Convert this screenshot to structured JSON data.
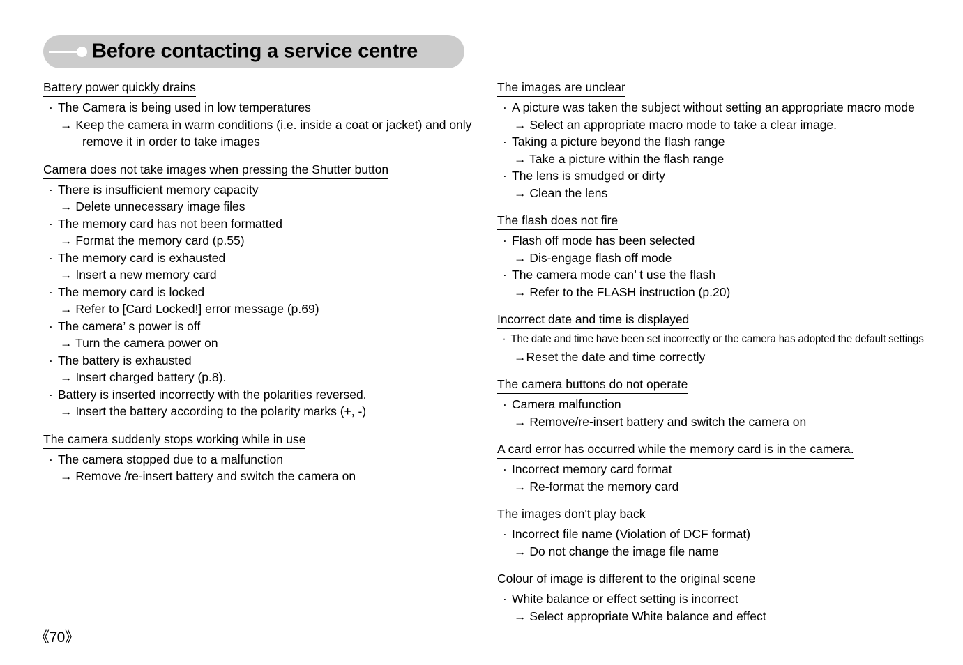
{
  "header": {
    "title": "Before contacting a service centre",
    "line_icon": "horizontal-line-decoration",
    "dot_icon": "bullet-dot-decoration",
    "background_color": "#cccccc"
  },
  "footer": {
    "page_number": "《70》"
  },
  "left_column": {
    "sections": [
      {
        "heading": "Battery power quickly drains",
        "items": [
          {
            "problem": "The Camera is being used in low temperatures",
            "solution": "→ Keep the camera in warm conditions (i.e. inside a coat or jacket) and only",
            "continuation": "remove it in order to take images"
          }
        ]
      },
      {
        "heading": "Camera does not take images when pressing the Shutter button",
        "items": [
          {
            "problem": "There is insufficient memory capacity",
            "solution": "→ Delete unnecessary image files"
          },
          {
            "problem": "The memory card has not been formatted",
            "solution": "→ Format the memory card (p.55)"
          },
          {
            "problem": "The memory card is exhausted",
            "solution": "→ Insert a new memory card"
          },
          {
            "problem": "The memory card is locked",
            "solution": "→ Refer to [Card Locked!] error message (p.69)"
          },
          {
            "problem": "The camera’ s power is off",
            "solution": "→ Turn the camera power on"
          },
          {
            "problem": "The battery is exhausted",
            "solution": "→ Insert charged battery (p.8)."
          },
          {
            "problem": "Battery is inserted incorrectly with the polarities reversed.",
            "solution": "→ Insert the battery according to the polarity marks (+, -)"
          }
        ]
      },
      {
        "heading": "The camera suddenly stops working while in use",
        "items": [
          {
            "problem": "The camera stopped due to a malfunction",
            "solution": "→ Remove /re-insert battery and switch the camera on"
          }
        ]
      }
    ]
  },
  "right_column": {
    "sections": [
      {
        "heading": "The images are unclear",
        "items": [
          {
            "problem": "A picture was taken the subject without setting an appropriate macro mode",
            "solution": "→ Select an appropriate macro mode to take a clear image."
          },
          {
            "problem": "Taking a picture beyond the flash range",
            "solution": "→ Take a picture within the flash range"
          },
          {
            "problem": "The lens is smudged or dirty",
            "solution": "→ Clean the lens"
          }
        ]
      },
      {
        "heading": "The flash does not fire",
        "items": [
          {
            "problem": "Flash off mode has been selected",
            "solution": "→ Dis-engage flash off mode"
          },
          {
            "problem": "The camera mode can’ t use the flash",
            "solution": "→ Refer to the FLASH instruction (p.20)"
          }
        ]
      },
      {
        "heading": "Incorrect date and time is displayed",
        "items": [
          {
            "problem": "The date and time have been set incorrectly or the camera has adopted the default settings",
            "solution": "→Reset the date and time correctly"
          }
        ]
      },
      {
        "heading": "The camera buttons do not operate",
        "items": [
          {
            "problem": "Camera malfunction",
            "solution": "→ Remove/re-insert battery and switch the camera on"
          }
        ]
      },
      {
        "heading": "A card error has occurred while the memory card is in the camera.",
        "items": [
          {
            "problem": "Incorrect memory card format",
            "solution": "→ Re-format the memory card"
          }
        ]
      },
      {
        "heading": "The images don't play back",
        "items": [
          {
            "problem": "Incorrect file name (Violation of DCF format)",
            "solution": "→ Do not change the image file name"
          }
        ]
      },
      {
        "heading": "Colour of image is different to the original scene",
        "items": [
          {
            "problem": "White balance or effect setting is incorrect",
            "solution": "→ Select appropriate White balance and effect"
          }
        ]
      }
    ]
  }
}
